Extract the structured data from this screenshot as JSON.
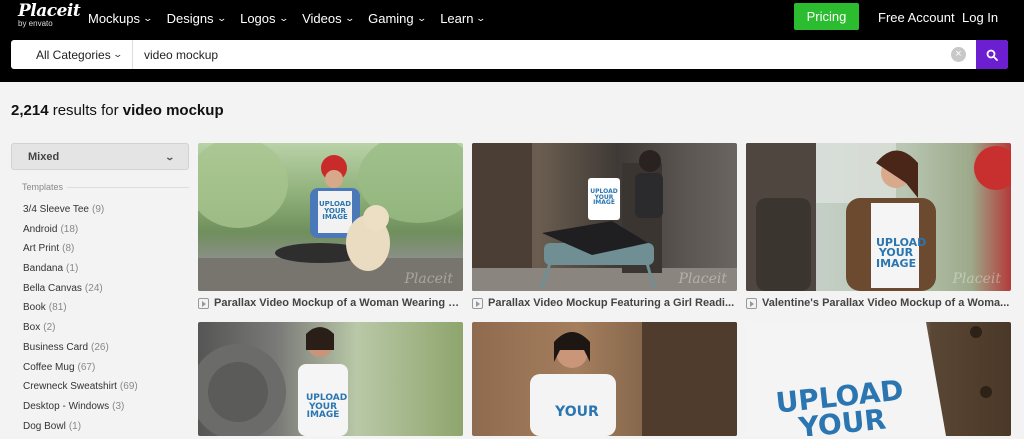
{
  "header": {
    "logo_brand": "Placeit",
    "logo_sub": "by envato",
    "nav": [
      {
        "label": "Mockups"
      },
      {
        "label": "Designs"
      },
      {
        "label": "Logos"
      },
      {
        "label": "Videos"
      },
      {
        "label": "Gaming"
      },
      {
        "label": "Learn"
      }
    ],
    "pricing_label": "Pricing",
    "free_account_label": "Free Account",
    "login_label": "Log In"
  },
  "search": {
    "category_label": "All Categories",
    "query": "video mockup",
    "clear_glyph": "×"
  },
  "results": {
    "count": "2,214",
    "text": "results for",
    "query": "video mockup"
  },
  "sidebar": {
    "sort_label": "Mixed",
    "section_title": "Templates",
    "items": [
      {
        "label": "3/4 Sleeve Tee",
        "count": "(9)"
      },
      {
        "label": "Android",
        "count": "(18)"
      },
      {
        "label": "Art Print",
        "count": "(8)"
      },
      {
        "label": "Bandana",
        "count": "(1)"
      },
      {
        "label": "Bella Canvas",
        "count": "(24)"
      },
      {
        "label": "Book",
        "count": "(81)"
      },
      {
        "label": "Box",
        "count": "(2)"
      },
      {
        "label": "Business Card",
        "count": "(26)"
      },
      {
        "label": "Coffee Mug",
        "count": "(67)"
      },
      {
        "label": "Crewneck Sweatshirt",
        "count": "(69)"
      },
      {
        "label": "Desktop - Windows",
        "count": "(3)"
      },
      {
        "label": "Dog Bowl",
        "count": "(1)"
      }
    ]
  },
  "grid": {
    "watermark": "Placeit",
    "tee_upload": "UPLOAD",
    "tee_your": "YOUR",
    "tee_image": "IMAGE",
    "cards": [
      {
        "title": "Parallax Video Mockup of a Woman Wearing a..."
      },
      {
        "title": "Parallax Video Mockup Featuring a Girl Readi..."
      },
      {
        "title": "Valentine's Parallax Video Mockup of a Woma..."
      }
    ]
  }
}
